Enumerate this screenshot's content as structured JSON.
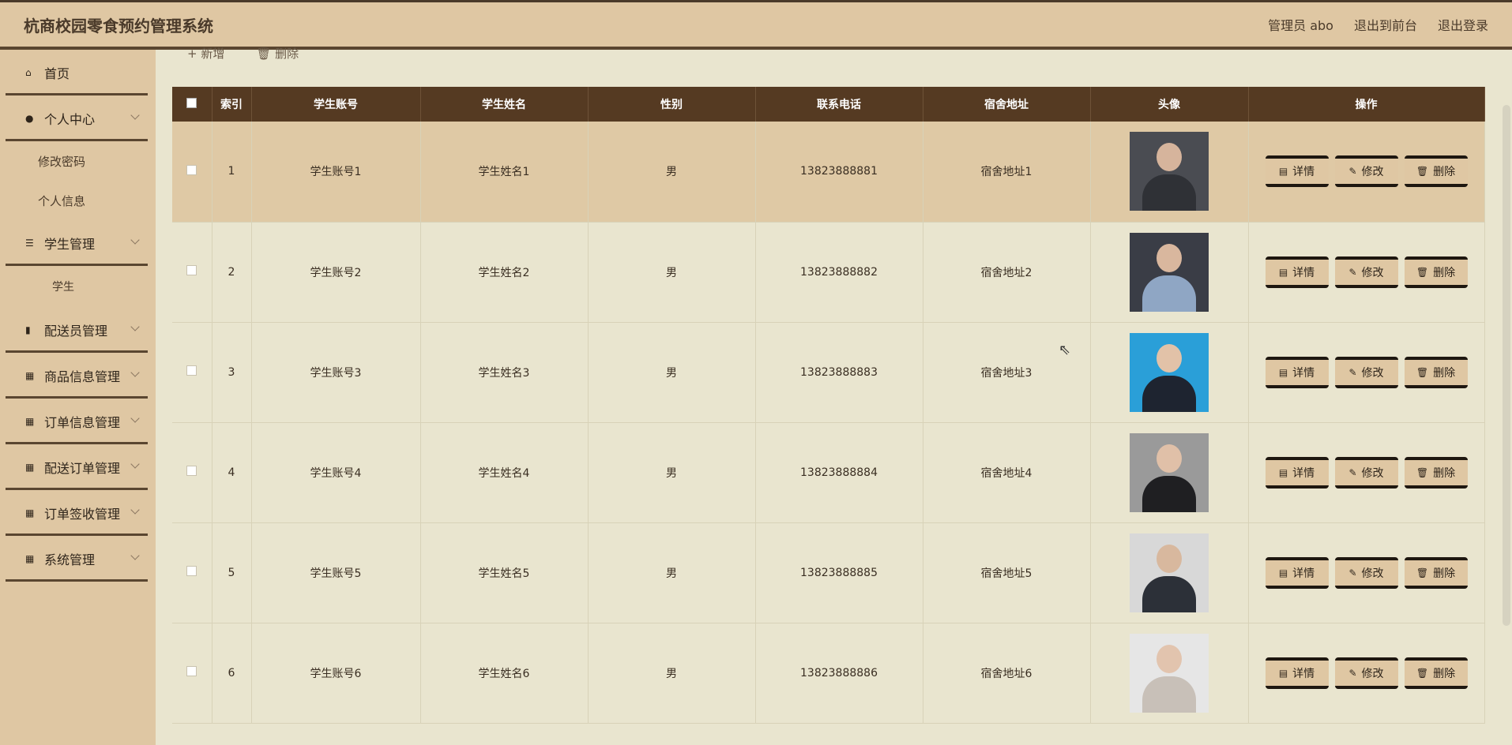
{
  "header": {
    "title": "杭商校园零食预约管理系统",
    "admin": "管理员 abo",
    "to_front": "退出到前台",
    "logout": "退出登录"
  },
  "sidebar": {
    "home": "首页",
    "personal": "个人中心",
    "change_pwd": "修改密码",
    "personal_info": "个人信息",
    "student_mgmt": "学生管理",
    "student": "学生",
    "courier_mgmt": "配送员管理",
    "goods_mgmt": "商品信息管理",
    "order_mgmt": "订单信息管理",
    "delivery_mgmt": "配送订单管理",
    "receipt_mgmt": "订单签收管理",
    "system_mgmt": "系统管理"
  },
  "toolbar": {
    "add": "+ 新增",
    "delete": "🗑 删除"
  },
  "table": {
    "headers": {
      "index": "索引",
      "account": "学生账号",
      "name": "学生姓名",
      "gender": "性别",
      "phone": "联系电话",
      "address": "宿舍地址",
      "avatar": "头像",
      "ops": "操作"
    },
    "rows": [
      {
        "index": "1",
        "account": "学生账号1",
        "name": "学生姓名1",
        "gender": "男",
        "phone": "13823888881",
        "address": "宿舍地址1"
      },
      {
        "index": "2",
        "account": "学生账号2",
        "name": "学生姓名2",
        "gender": "男",
        "phone": "13823888882",
        "address": "宿舍地址2"
      },
      {
        "index": "3",
        "account": "学生账号3",
        "name": "学生姓名3",
        "gender": "男",
        "phone": "13823888883",
        "address": "宿舍地址3"
      },
      {
        "index": "4",
        "account": "学生账号4",
        "name": "学生姓名4",
        "gender": "男",
        "phone": "13823888884",
        "address": "宿舍地址4"
      },
      {
        "index": "5",
        "account": "学生账号5",
        "name": "学生姓名5",
        "gender": "男",
        "phone": "13823888885",
        "address": "宿舍地址5"
      },
      {
        "index": "6",
        "account": "学生账号6",
        "name": "学生姓名6",
        "gender": "男",
        "phone": "13823888886",
        "address": "宿舍地址6"
      }
    ],
    "btn_detail": "详情",
    "btn_edit": "修改",
    "btn_delete": "删除"
  },
  "colors": {
    "header_bg": "#dfc7a3",
    "table_head": "#553a22",
    "content_bg": "#e9e5cf"
  }
}
